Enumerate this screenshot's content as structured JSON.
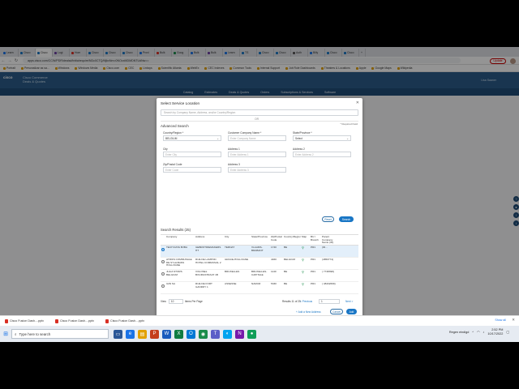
{
  "browser": {
    "tabs": [
      {
        "label": "Learn",
        "color": "#1a73e8",
        "active": false
      },
      {
        "label": "Cisco",
        "color": "#1976c5",
        "active": false
      },
      {
        "label": "Cisco",
        "color": "#1976c5",
        "active": true
      },
      {
        "label": "Logi",
        "color": "#6b3fa0",
        "active": false
      },
      {
        "label": "Hom",
        "color": "#d93025",
        "active": false
      },
      {
        "label": "Cisco",
        "color": "#1976c5",
        "active": false
      },
      {
        "label": "Cisco",
        "color": "#1976c5",
        "active": false
      },
      {
        "label": "Cisco",
        "color": "#1976c5",
        "active": false
      },
      {
        "label": "Provi",
        "color": "#1a73e8",
        "active": false
      },
      {
        "label": "Bulk",
        "color": "#d93025",
        "active": false
      },
      {
        "label": "Goog",
        "color": "#1a8c4a",
        "active": false
      },
      {
        "label": "Bulk",
        "color": "#1a73e8",
        "active": false
      },
      {
        "label": "Bulk",
        "color": "#6b3fa0",
        "active": false
      },
      {
        "label": "Learn",
        "color": "#1a73e8",
        "active": false
      },
      {
        "label": "TS",
        "color": "#1976c5",
        "active": false
      },
      {
        "label": "Cisco",
        "color": "#1976c5",
        "active": false
      },
      {
        "label": "Cisco",
        "color": "#1976c5",
        "active": false
      },
      {
        "label": "Auth",
        "color": "#555555",
        "active": false
      },
      {
        "label": "Billy",
        "color": "#1a73e8",
        "active": false
      },
      {
        "label": "Cisco",
        "color": "#1976c5",
        "active": false
      },
      {
        "label": "Cisco",
        "color": "#1976c5",
        "active": false
      }
    ],
    "url": "apps.cisco.com/CCW/PDR/deals#/initialrequire/NDc0CTQ/MjkxNm=0NOcxMDMDNTUdNw==",
    "update_label": "Update",
    "bookmarks": [
      "Portrait",
      "Personalizar as sa...",
      "Windows",
      "Windows Media",
      "Cisco.com",
      "CEC",
      "Linksys",
      "Scientific Atlanta",
      "WebEx",
      "CEC Indexes",
      "Common Tools",
      "Internal Support",
      "Job Role Dashboards",
      "Theatres & Locations",
      "Apple",
      "Google Maps",
      "Wikipedia"
    ]
  },
  "app": {
    "logo": "cisco",
    "title_line1": "Cisco Commerce",
    "title_line2": "Deals & Quotes",
    "user": "Lisa Saaner",
    "nav": [
      "Catalog",
      "Estimates",
      "Deals & Quotes",
      "Orders",
      "Subscriptions & Services",
      "Software"
    ]
  },
  "modal": {
    "title": "Select Service Location",
    "search_placeholder": "Search by Company Name, Address, and/or Country/Region",
    "or_text": "OR",
    "required_note": "* Required Field",
    "advanced_title": "Advanced Search",
    "fields": {
      "country_label": "Country/Region *",
      "country_value": "BELGIUM",
      "company_label": "Customer Company Name *",
      "company_placeholder": "Enter Company Name",
      "state_label": "State/Province *",
      "state_value": "Select",
      "city_label": "City",
      "city_placeholder": "Enter City",
      "address1_label": "Address 1",
      "address1_placeholder": "Enter Address 1",
      "address2_label": "Address 2",
      "address2_placeholder": "Enter Address 2",
      "zip_label": "Zip/Postal Code",
      "zip_placeholder": "Enter Code",
      "address3_label": "Address 3",
      "address3_placeholder": "Enter Address 3"
    },
    "reset_label": "Reset",
    "search_label": "Search",
    "results_title": "Search Results (25)",
    "columns": [
      "",
      "Company",
      "Address",
      "City",
      "State/Province",
      "Zip/Postal Code",
      "Country/Region",
      "Map",
      "BU / Branch",
      "Parent Company Name (ID)"
    ],
    "rows": [
      {
        "company": "TECH DATA BVBA",
        "address": "GEBROTRIEMAKERS HT",
        "city": "TERNAT",
        "state": "VLAAMS-BRABANT",
        "zip": "1740",
        "country": "BE",
        "bu": "PR1",
        "parent": "(ID...",
        "selected": true
      },
      {
        "company": "ATRIFS COMMUNALE DE ST-ALBANS HOLLOGNE",
        "address": "RUE DE LAMPOD HOTEL COMMUNAL 2",
        "city": "GRACE-HOLLOGNE",
        "state": "",
        "zip": "4460",
        "country": "BELGIUM",
        "bu": "PR1",
        "parent": "(4850774)",
        "selected": false
      },
      {
        "company": "JULIA STORS BELGIUM",
        "address": "VOLOSEL BOURGSTRAAT 1B",
        "city": "BRUXELLES",
        "state": "BRUXELLES-CAPITALE",
        "zip": "1140",
        "country": "BE",
        "bu": "PR1",
        "parent": "( 7748398)",
        "selected": false
      },
      {
        "company": "IAIN SA",
        "address": "RUE DE FORT GANDDY 1",
        "city": "ASSESSE",
        "state": "NAMUR",
        "zip": "5330",
        "country": "BE",
        "bu": "PR1",
        "parent": "( 48432669)",
        "selected": false
      }
    ],
    "pager": {
      "view_label": "View",
      "view_value": "10",
      "ipp_label": "Items Per Page",
      "results_text": "Results 11 of 25",
      "prev_label": "< Previous",
      "page_value": "1",
      "next_label": "Next >"
    },
    "add_link": "+ Add a New Address",
    "cancel_label": "Cancel",
    "add_label": "Add"
  },
  "downloads": {
    "items": [
      "Cisco Fusion Dash....pptx",
      "Cisco Fusion Dash....pptx",
      "Cisco Fusion Dash....pptx"
    ],
    "show_all": "Show all"
  },
  "taskbar": {
    "search_placeholder": "Type here to search",
    "weather": "Regen eindigd",
    "time": "2:52 PM",
    "date": "10/17/2022"
  }
}
